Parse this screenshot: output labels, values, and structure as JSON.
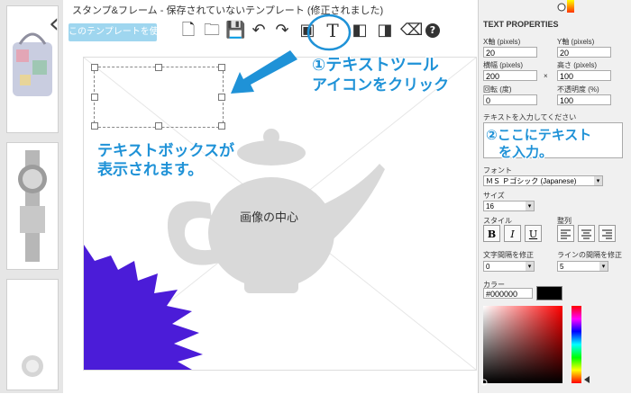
{
  "editor": {
    "title": "スタンプ&フレーム  -  保存されていないテンプレート (修正されました)",
    "use_template_button": "このテンプレートを使用",
    "center_label": "画像の中心"
  },
  "toolbar": {
    "tools": [
      {
        "name": "new-page-icon",
        "glyph": "🗋"
      },
      {
        "name": "folder-icon",
        "glyph": "🗀"
      },
      {
        "name": "save-icon",
        "glyph": "💾"
      },
      {
        "name": "undo-icon",
        "glyph": "↶"
      },
      {
        "name": "redo-icon",
        "glyph": "↷"
      },
      {
        "name": "image-icon",
        "glyph": "▣"
      },
      {
        "name": "text-tool-icon",
        "glyph": "T"
      },
      {
        "name": "bring-front-icon",
        "glyph": "◧"
      },
      {
        "name": "send-back-icon",
        "glyph": "◨"
      },
      {
        "name": "eraser-icon",
        "glyph": "⌫"
      },
      {
        "name": "help-icon",
        "glyph": "?"
      }
    ]
  },
  "annotations": {
    "callout1_line1": "①テキストツール",
    "callout1_line2": "アイコンをクリック",
    "textbox_line1": "テキストボックスが",
    "textbox_line2": "表示されます。",
    "callout2_line1": "②ここにテキスト",
    "callout2_line2": "を入力。"
  },
  "panel": {
    "header": "TEXT PROPERTIES",
    "x_label": "X軸 (pixels)",
    "x_value": "20",
    "y_label": "Y軸 (pixels)",
    "y_value": "20",
    "width_label": "横幅 (pixels)",
    "width_value": "200",
    "times": "×",
    "height_label": "高さ (pixels)",
    "height_value": "100",
    "rotation_label": "回転 (度)",
    "rotation_value": "0",
    "opacity_label": "不透明度 (%)",
    "opacity_value": "100",
    "text_prompt": "テキストを入力してください",
    "font_label": "フォント",
    "font_value": "ＭＳ Ｐゴシック (Japanese)",
    "size_label": "サイズ",
    "size_value": "16",
    "style_label": "スタイル",
    "bold_label": "B",
    "italic_label": "I",
    "underline_label": "U",
    "align_label": "整列",
    "letter_spacing_label": "文字間隔を修正",
    "letter_spacing_value": "0",
    "line_spacing_label": "ラインの間隔を修正",
    "line_spacing_value": "5",
    "color_label": "カラー",
    "color_value": "#000000"
  },
  "colors": {
    "accent": "#1f92d7",
    "starburst": "#4b1cd8",
    "teapot": "#d9d9d9"
  }
}
